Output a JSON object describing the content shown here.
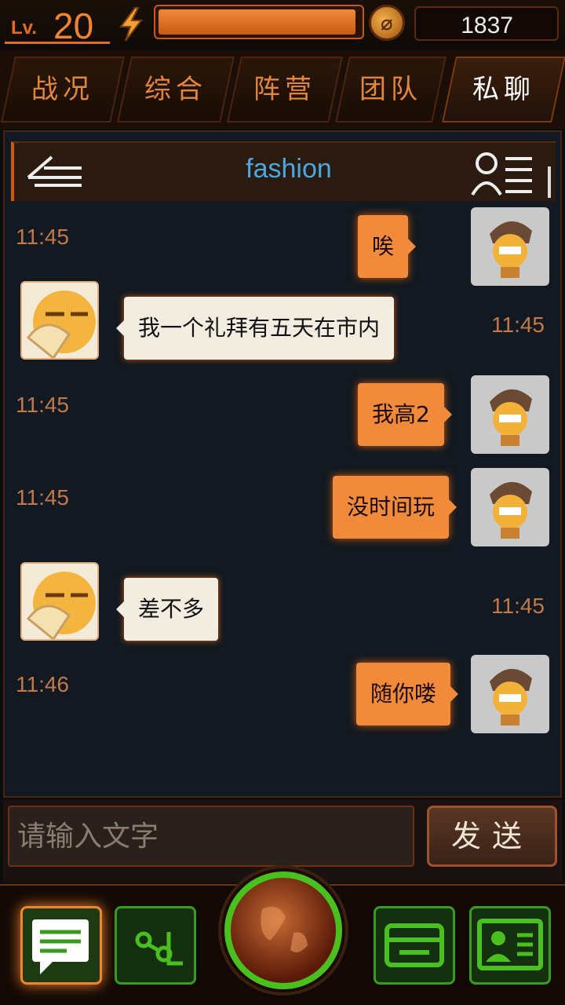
{
  "status_bar": {
    "level_label": "Lv.",
    "level_value": "20",
    "energy_fraction": 0.98,
    "coins": "1837"
  },
  "tabs": [
    {
      "label": "战况",
      "active": false
    },
    {
      "label": "综合",
      "active": false
    },
    {
      "label": "阵营",
      "active": false
    },
    {
      "label": "团队",
      "active": false
    },
    {
      "label": "私聊",
      "active": true
    }
  ],
  "chat": {
    "title": "fashion",
    "messages": [
      {
        "side": "out",
        "text": "唉",
        "time": "11:45"
      },
      {
        "side": "in",
        "text": "我一个礼拜有五天在市内",
        "time": "11:45"
      },
      {
        "side": "out",
        "text": "我高2",
        "time": "11:45"
      },
      {
        "side": "out",
        "text": "没时间玩",
        "time": "11:45"
      },
      {
        "side": "in",
        "text": "差不多",
        "time": "11:45"
      },
      {
        "side": "out",
        "text": "随你喽",
        "time": "11:46"
      }
    ]
  },
  "composer": {
    "placeholder": "请输入文字",
    "send_label": "发送"
  },
  "bottom_nav": {
    "items": [
      "chat-icon",
      "share-icon",
      "globe-icon",
      "shop-icon",
      "profile-card-icon"
    ],
    "accent": "#4ac01e",
    "active_accent": "#f0852e"
  }
}
